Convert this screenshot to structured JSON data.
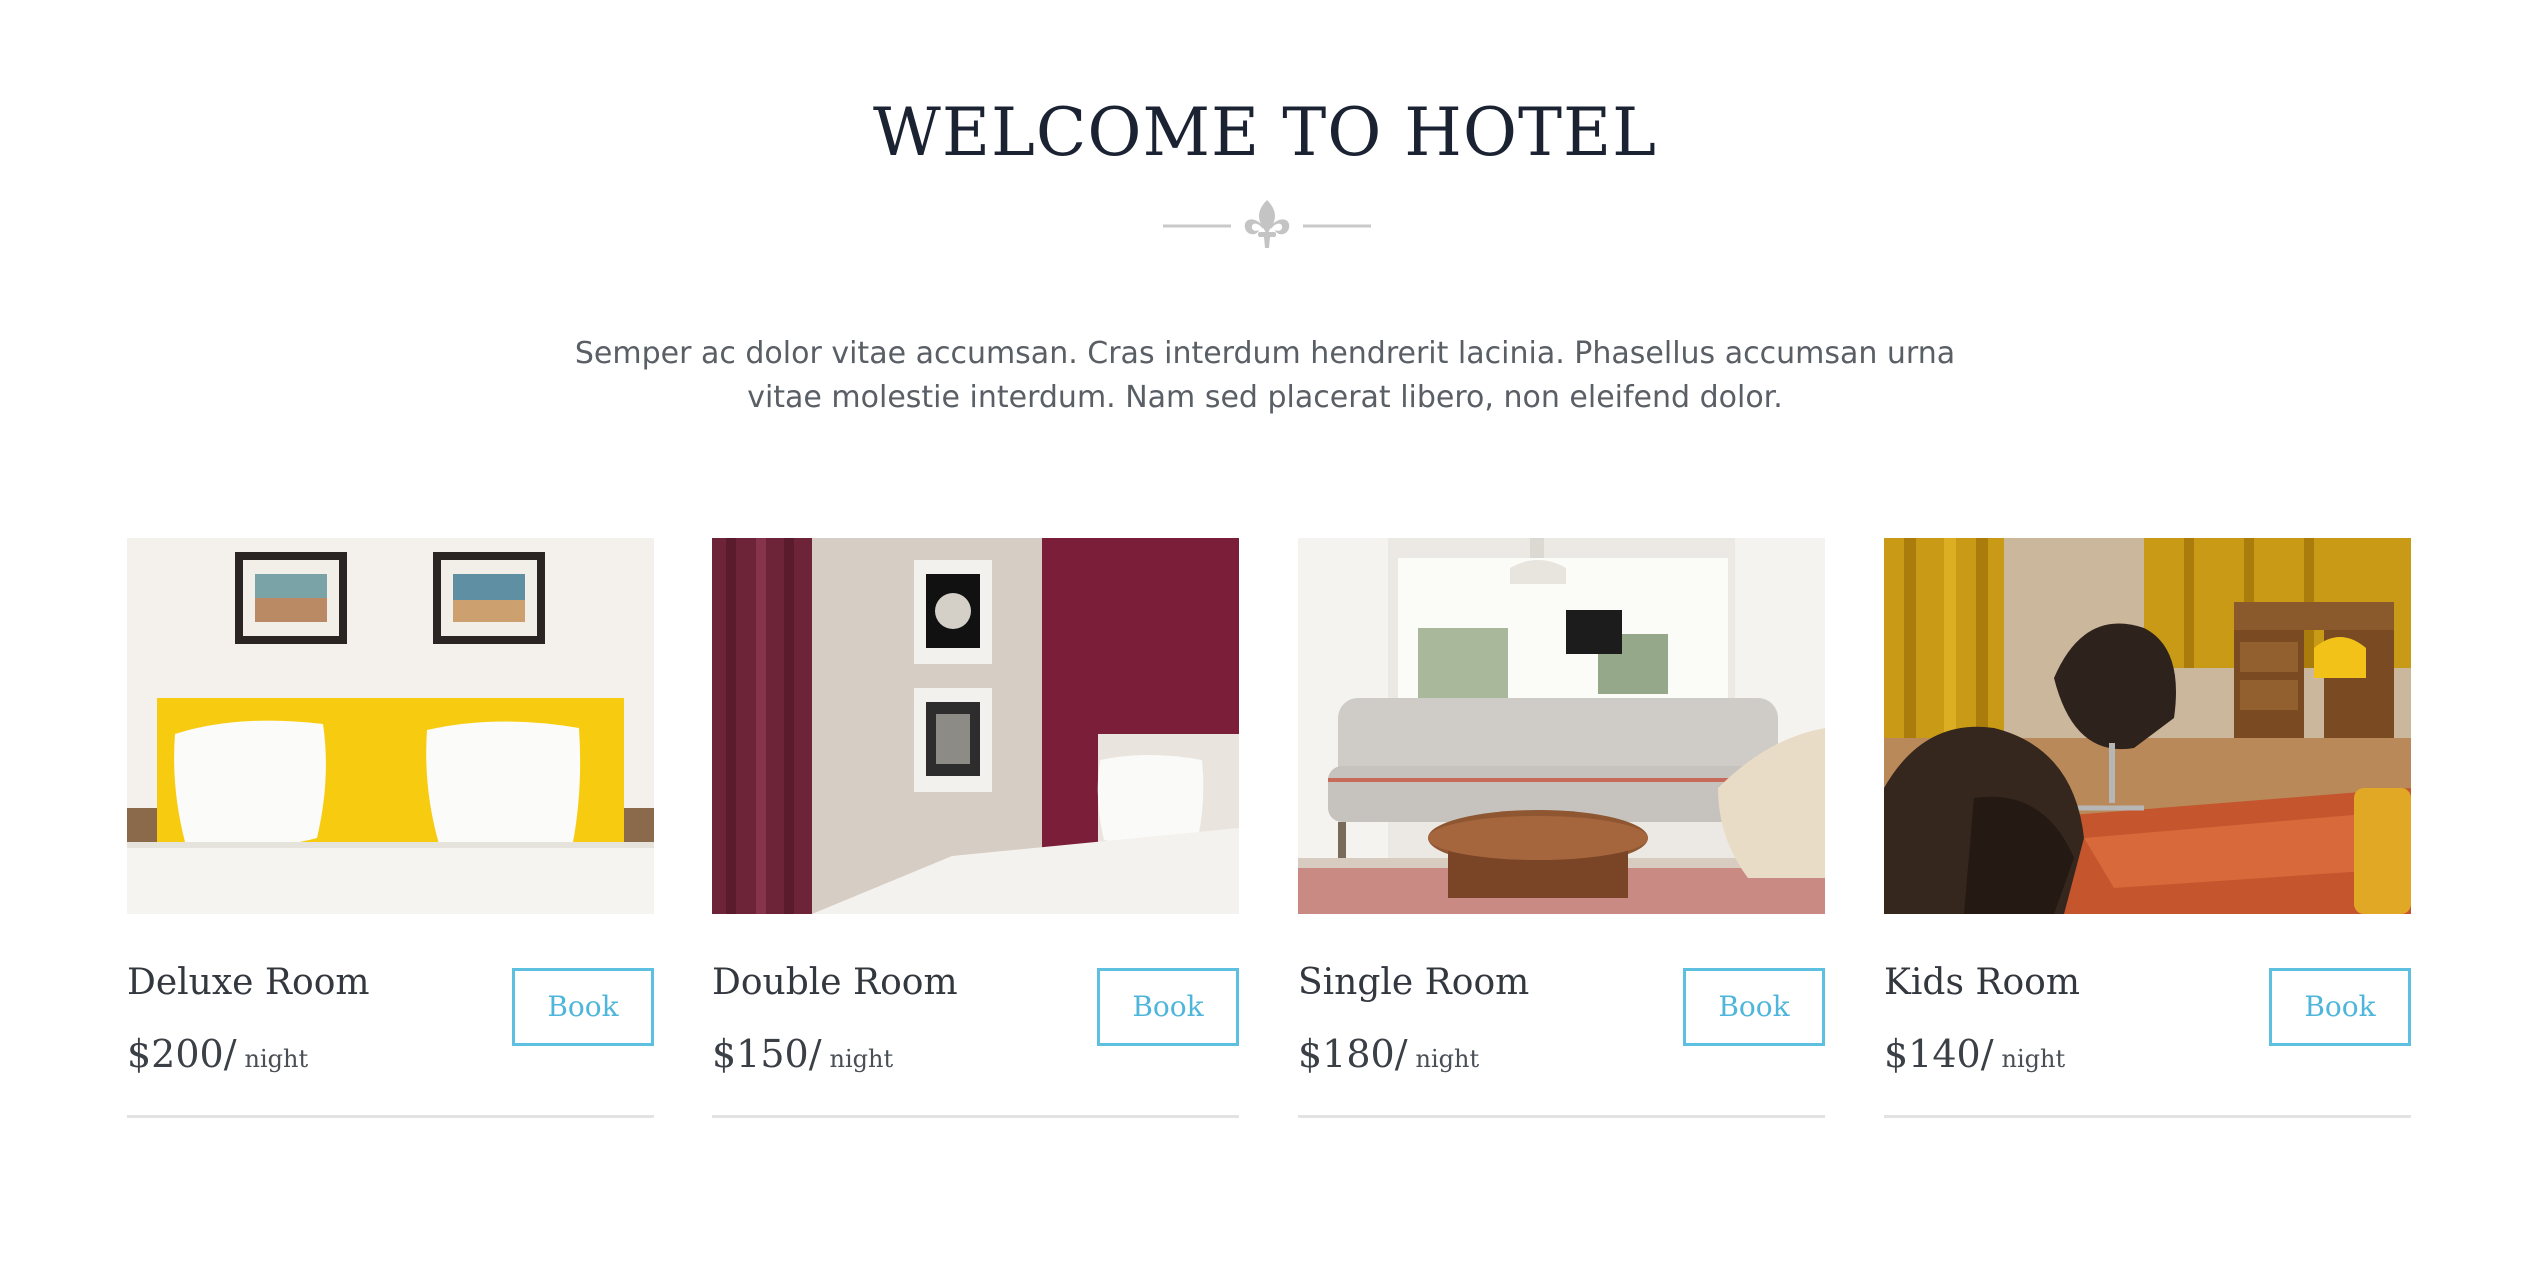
{
  "header": {
    "title": "WELCOME TO HOTEL",
    "intro": "Semper ac dolor vitae accumsan. Cras interdum hendrerit lacinia. Phasellus accumsan urna vitae molestie interdum. Nam sed placerat libero, non eleifend dolor."
  },
  "rooms": [
    {
      "name": "Deluxe Room",
      "price": "$200",
      "unit": "night",
      "book_label": "Book"
    },
    {
      "name": "Double Room",
      "price": "$150",
      "unit": "night",
      "book_label": "Book"
    },
    {
      "name": "Single Room",
      "price": "$180",
      "unit": "night",
      "book_label": "Book"
    },
    {
      "name": "Kids Room",
      "price": "$140",
      "unit": "night",
      "book_label": "Book"
    }
  ],
  "colors": {
    "title": "#1b2333",
    "accent": "#5ec0e0",
    "divider": "#c9c9c9"
  },
  "icons": {
    "divider": "fleur-de-lis-icon"
  }
}
